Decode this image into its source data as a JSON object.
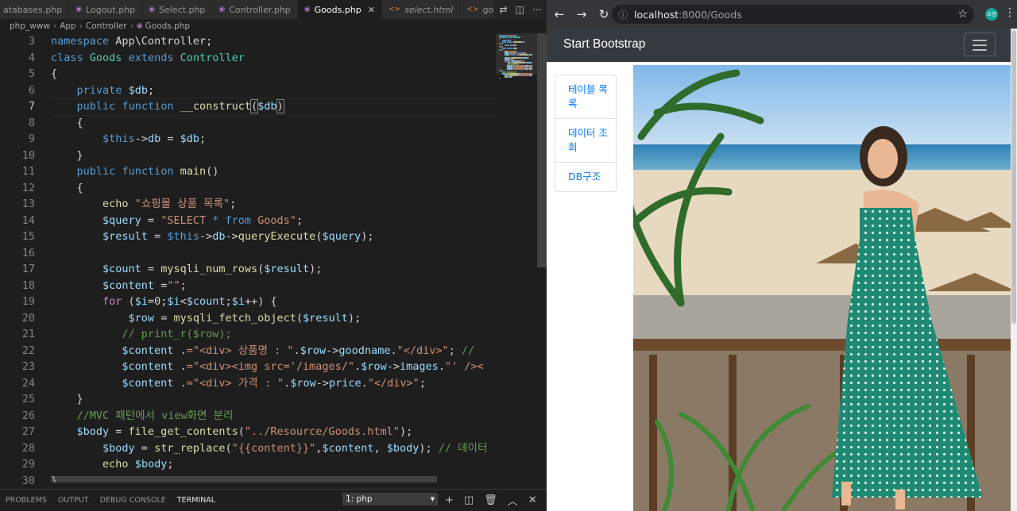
{
  "editor": {
    "tabs": [
      {
        "label": "atabases.php",
        "icon": "php-file-icon",
        "active": false,
        "italic": false
      },
      {
        "label": "Logout.php",
        "icon": "php-file-icon",
        "active": false,
        "italic": false
      },
      {
        "label": "Select.php",
        "icon": "php-file-icon",
        "active": false,
        "italic": false
      },
      {
        "label": "Controller.php",
        "icon": "php-file-icon",
        "active": false,
        "italic": false
      },
      {
        "label": "Goods.php",
        "icon": "php-file-icon",
        "active": true,
        "italic": false
      },
      {
        "label": "select.html",
        "icon": "html-file-icon",
        "active": false,
        "italic": true
      },
      {
        "label": "goo",
        "icon": "html-file-icon",
        "active": false,
        "italic": false
      }
    ],
    "breadcrumb": [
      "php_www",
      "App",
      "Controller",
      "Goods.php"
    ],
    "line_numbers": [
      "3",
      "4",
      "5",
      "6",
      "7",
      "8",
      "9",
      "10",
      "11",
      "12",
      "13",
      "14",
      "15",
      "16",
      "17",
      "18",
      "19",
      "20",
      "21",
      "22",
      "23",
      "24",
      "25",
      "26",
      "27",
      "28",
      "29",
      "30"
    ],
    "current_line": "7",
    "code_lines": [
      [
        [
          "kw",
          "namespace"
        ],
        [
          "",
          "&nbsp;App\\Controller;"
        ]
      ],
      [
        [
          "kw",
          "class"
        ],
        [
          "",
          " "
        ],
        [
          "cls",
          "Goods"
        ],
        [
          "",
          " "
        ],
        [
          "kw",
          "extends"
        ],
        [
          "",
          " "
        ],
        [
          "cls",
          "Controller"
        ]
      ],
      [
        [
          "",
          "{"
        ]
      ],
      [
        [
          "",
          "    "
        ],
        [
          "kw",
          "private"
        ],
        [
          "",
          " "
        ],
        [
          "var",
          "$db"
        ],
        [
          "",
          ";"
        ]
      ],
      [
        [
          "",
          "    "
        ],
        [
          "kw",
          "public"
        ],
        [
          "",
          " "
        ],
        [
          "kw",
          "function"
        ],
        [
          "",
          " "
        ],
        [
          "fn",
          "__construct"
        ],
        [
          "paren",
          "("
        ],
        [
          "var",
          "$db"
        ],
        [
          "paren",
          ")"
        ]
      ],
      [
        [
          "",
          "    {"
        ]
      ],
      [
        [
          "",
          "        "
        ],
        [
          "kw",
          "$this"
        ],
        [
          "",
          "->"
        ],
        [
          "var",
          "db"
        ],
        [
          "",
          " = "
        ],
        [
          "var",
          "$db"
        ],
        [
          "",
          ";"
        ]
      ],
      [
        [
          "",
          "    }"
        ]
      ],
      [
        [
          "",
          "    "
        ],
        [
          "kw",
          "public"
        ],
        [
          "",
          " "
        ],
        [
          "kw",
          "function"
        ],
        [
          "",
          " "
        ],
        [
          "fn",
          "main"
        ],
        [
          "",
          "()"
        ]
      ],
      [
        [
          "",
          "    {"
        ]
      ],
      [
        [
          "",
          "        "
        ],
        [
          "fn",
          "echo"
        ],
        [
          "",
          " "
        ],
        [
          "str",
          "\"쇼핑몰 상품 목록\""
        ],
        [
          "",
          ";"
        ]
      ],
      [
        [
          "",
          "        "
        ],
        [
          "var",
          "$query"
        ],
        [
          "",
          " = "
        ],
        [
          "str",
          "\"SELECT "
        ],
        [
          "kw",
          "*"
        ],
        [
          "str",
          " "
        ],
        [
          "kw",
          "from"
        ],
        [
          "str",
          " Goods\""
        ],
        [
          "",
          ";"
        ]
      ],
      [
        [
          "",
          "        "
        ],
        [
          "var",
          "$result"
        ],
        [
          "",
          " = "
        ],
        [
          "kw",
          "$this"
        ],
        [
          "",
          "->"
        ],
        [
          "var",
          "db"
        ],
        [
          "",
          "->"
        ],
        [
          "fn",
          "queryExecute"
        ],
        [
          "",
          "("
        ],
        [
          "var",
          "$query"
        ],
        [
          "",
          ");"
        ]
      ],
      [
        [
          "",
          ""
        ]
      ],
      [
        [
          "",
          "        "
        ],
        [
          "var",
          "$count"
        ],
        [
          "",
          " = "
        ],
        [
          "fn",
          "mysqli_num_rows"
        ],
        [
          "",
          "("
        ],
        [
          "var",
          "$result"
        ],
        [
          "",
          ");"
        ]
      ],
      [
        [
          "",
          "        "
        ],
        [
          "var",
          "$content"
        ],
        [
          "",
          " ="
        ],
        [
          "str",
          "\"\""
        ],
        [
          "",
          ";"
        ]
      ],
      [
        [
          "",
          "        "
        ],
        [
          "ctl",
          "for"
        ],
        [
          "",
          " ("
        ],
        [
          "var",
          "$i"
        ],
        [
          "",
          "=0;"
        ],
        [
          "var",
          "$i"
        ],
        [
          "",
          "<"
        ],
        [
          "var",
          "$count"
        ],
        [
          "",
          ";"
        ],
        [
          "var",
          "$i"
        ],
        [
          "",
          "++) {"
        ]
      ],
      [
        [
          "",
          "            "
        ],
        [
          "var",
          "$row"
        ],
        [
          "",
          " = "
        ],
        [
          "fn",
          "mysqli_fetch_object"
        ],
        [
          "",
          "("
        ],
        [
          "var",
          "$result"
        ],
        [
          "",
          ");"
        ]
      ],
      [
        [
          "",
          "           "
        ],
        [
          "cmt",
          "// print_r($row);"
        ]
      ],
      [
        [
          "",
          "           "
        ],
        [
          "var",
          "$content"
        ],
        [
          "",
          " ."
        ],
        [
          "str",
          "=\"<div> 상품명 : \""
        ],
        [
          "",
          "."
        ],
        [
          "var",
          "$row"
        ],
        [
          "",
          "->"
        ],
        [
          "var",
          "goodname"
        ],
        [
          "",
          "."
        ],
        [
          "str",
          "\"</div>\""
        ],
        [
          "",
          "; "
        ],
        [
          "cmt",
          "//"
        ]
      ],
      [
        [
          "",
          "           "
        ],
        [
          "var",
          "$content"
        ],
        [
          "",
          " ."
        ],
        [
          "str",
          "=\"<div><img src='/images/\""
        ],
        [
          "",
          "."
        ],
        [
          "var",
          "$row"
        ],
        [
          "",
          "->"
        ],
        [
          "var",
          "images"
        ],
        [
          "",
          "."
        ],
        [
          "str",
          "\"' /><"
        ]
      ],
      [
        [
          "",
          "           "
        ],
        [
          "var",
          "$content"
        ],
        [
          "",
          " ."
        ],
        [
          "str",
          "=\"<div> 가격 : \""
        ],
        [
          "",
          "."
        ],
        [
          "var",
          "$row"
        ],
        [
          "",
          "->"
        ],
        [
          "var",
          "price"
        ],
        [
          "",
          "."
        ],
        [
          "str",
          "\"</div>\""
        ],
        [
          "",
          ";"
        ]
      ],
      [
        [
          "",
          "    }"
        ]
      ],
      [
        [
          "",
          "    "
        ],
        [
          "cmt",
          "//MVC 패턴에서 view화면 분리"
        ]
      ],
      [
        [
          "",
          "    "
        ],
        [
          "var",
          "$body"
        ],
        [
          "",
          " = "
        ],
        [
          "fn",
          "file_get_contents"
        ],
        [
          "",
          "("
        ],
        [
          "str",
          "\"../Resource/Goods.html\""
        ],
        [
          "",
          ");"
        ]
      ],
      [
        [
          "",
          "        "
        ],
        [
          "var",
          "$body"
        ],
        [
          "",
          " = "
        ],
        [
          "fn",
          "str_replace"
        ],
        [
          "",
          "("
        ],
        [
          "str",
          "\"{{content}}\""
        ],
        [
          "",
          ","
        ],
        [
          "var",
          "$content"
        ],
        [
          "",
          ", "
        ],
        [
          "var",
          "$body"
        ],
        [
          "",
          "); "
        ],
        [
          "cmt",
          "// 데이터"
        ]
      ],
      [
        [
          "",
          "        "
        ],
        [
          "fn",
          "echo"
        ],
        [
          "",
          " "
        ],
        [
          "var",
          "$body"
        ],
        [
          "",
          ";"
        ]
      ],
      [
        [
          "",
          "}"
        ]
      ]
    ],
    "panel_tabs": [
      "PROBLEMS",
      "OUTPUT",
      "DEBUG CONSOLE",
      "TERMINAL"
    ],
    "active_panel_tab": "TERMINAL",
    "terminal_select": "1: php"
  },
  "browser": {
    "url_host": "localhost",
    "url_rest": ":8000/Goods",
    "profile_initials": "호영",
    "brand": "Start Bootstrap",
    "side_items": [
      "테이블 목록",
      "데이터 조회",
      "DB구조"
    ]
  },
  "colors": {
    "editor_bg": "#1e1e1e",
    "keyword": "#569cd6",
    "string": "#ce9178",
    "comment": "#6a9955",
    "navbar": "#343a40",
    "link": "#007bff"
  }
}
